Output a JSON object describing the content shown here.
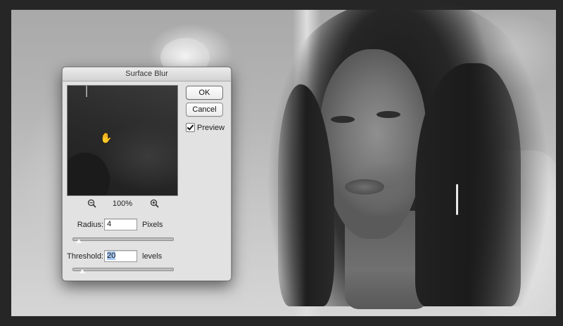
{
  "dialog": {
    "title": "Surface Blur",
    "ok_label": "OK",
    "cancel_label": "Cancel",
    "preview_label": "Preview",
    "preview_checked": true,
    "zoom_level": "100%",
    "zoom_out_icon": "zoom-out-icon",
    "zoom_in_icon": "zoom-in-icon",
    "radius": {
      "label": "Radius:",
      "value": "4",
      "unit": "Pixels",
      "slider_fraction": 0.04
    },
    "threshold": {
      "label": "Threshold:",
      "value": "20",
      "unit": "levels",
      "slider_fraction": 0.08
    }
  },
  "colors": {
    "dialog_bg": "#e2e2e2",
    "selection_highlight": "#a8c8f2",
    "app_background": "#262626"
  }
}
